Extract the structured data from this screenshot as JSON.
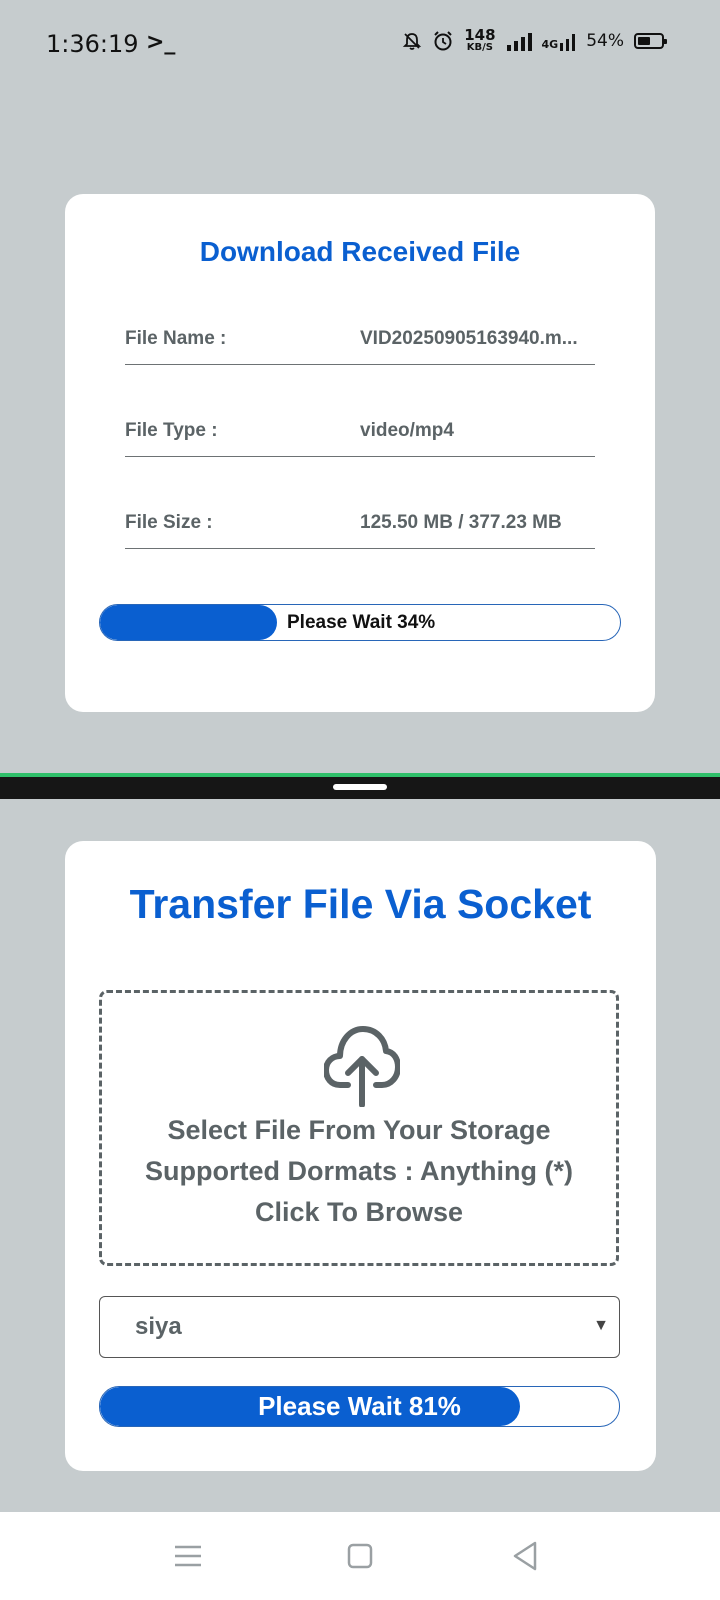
{
  "status_bar": {
    "time": "1:36:19",
    "terminal_glyph": ">_",
    "net_speed_value": "148",
    "net_speed_unit": "KB/S",
    "network_type": "4G",
    "battery_percent": "54%"
  },
  "download_card": {
    "title": "Download Received File",
    "rows": [
      {
        "label": "File Name :",
        "value": "VID20250905163940.m..."
      },
      {
        "label": "File Type :",
        "value": "video/mp4"
      },
      {
        "label": "File Size :",
        "value": "125.50 MB / 377.23 MB"
      }
    ],
    "progress": {
      "percent": 34,
      "text": "Please Wait 34%"
    }
  },
  "transfer_card": {
    "title": "Transfer File Via Socket",
    "drop_zone": {
      "icon": "cloud-upload-icon",
      "lines": [
        "Select File From Your Storage",
        "Supported Dormats : Anything (*)",
        "Click To Browse"
      ]
    },
    "recipient_select": {
      "value": "siya"
    },
    "progress": {
      "percent": 81,
      "text": "Please Wait 81%"
    }
  },
  "colors": {
    "accent": "#0a5fd0",
    "background": "#c6ccce",
    "text_muted": "#5b6366",
    "divider_accent": "#2fbf6a"
  }
}
